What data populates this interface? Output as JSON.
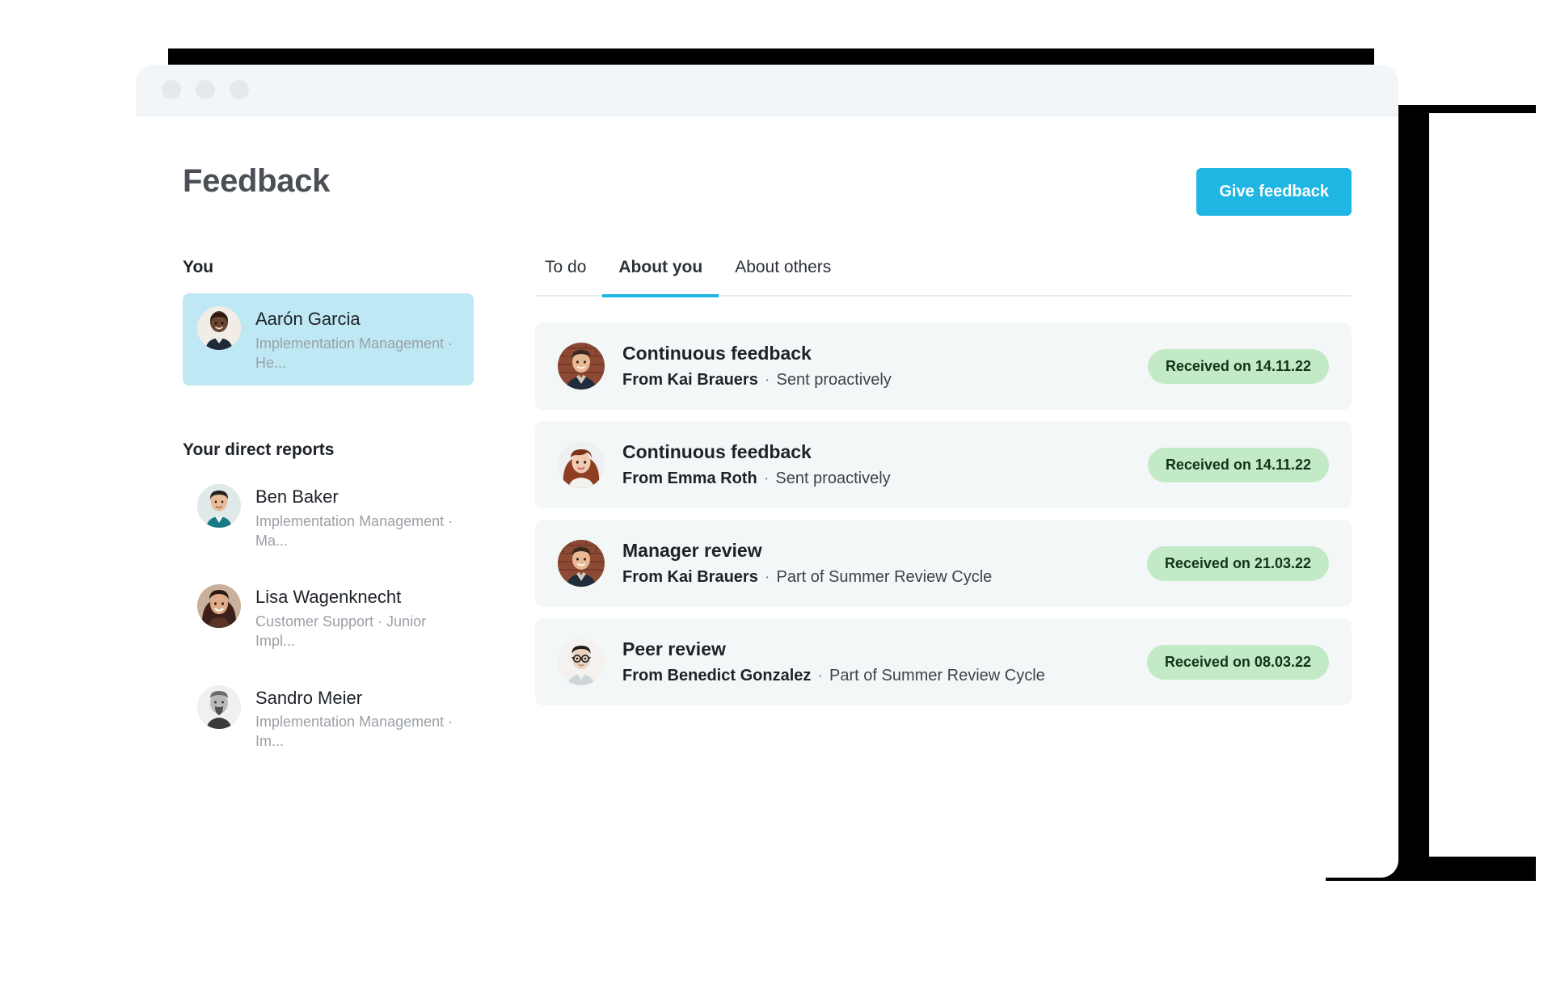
{
  "window": {
    "dots": [
      "close-dot",
      "minimize-dot",
      "maximize-dot"
    ]
  },
  "header": {
    "title": "Feedback",
    "give_feedback_label": "Give feedback",
    "accent_color": "#1fb6e3"
  },
  "sidebar": {
    "you_label": "You",
    "direct_reports_label": "Your direct reports",
    "you": {
      "name": "Aarón Garcia",
      "role": "Implementation Management · He...",
      "selected": true,
      "highlight_color": "#bfe8f5"
    },
    "direct_reports": [
      {
        "name": "Ben Baker",
        "role": "Implementation Management · Ma..."
      },
      {
        "name": "Lisa Wagenknecht",
        "role": "Customer Support · Junior Impl..."
      },
      {
        "name": "Sandro Meier",
        "role": "Implementation Management · Im..."
      }
    ]
  },
  "main": {
    "tabs": [
      {
        "label": "To do",
        "active": false
      },
      {
        "label": "About you",
        "active": true
      },
      {
        "label": "About others",
        "active": false
      }
    ],
    "feedback_items": [
      {
        "title": "Continuous feedback",
        "from": "From Kai Brauers",
        "separator": "·",
        "context": "Sent proactively",
        "status": "Received on 14.11.22",
        "status_color": "#c3eac6",
        "avatar": "kai-brauers"
      },
      {
        "title": "Continuous feedback",
        "from": "From Emma Roth",
        "separator": "·",
        "context": "Sent proactively",
        "status": "Received on 14.11.22",
        "status_color": "#c3eac6",
        "avatar": "emma-roth"
      },
      {
        "title": "Manager review",
        "from": "From Kai Brauers",
        "separator": "·",
        "context": "Part of Summer Review Cycle",
        "status": "Received on 21.03.22",
        "status_color": "#c3eac6",
        "avatar": "kai-brauers"
      },
      {
        "title": "Peer review",
        "from": "From Benedict Gonzalez",
        "separator": "·",
        "context": "Part of Summer Review Cycle",
        "status": "Received on 08.03.22",
        "status_color": "#c3eac6",
        "avatar": "benedict-gonzalez"
      }
    ]
  }
}
